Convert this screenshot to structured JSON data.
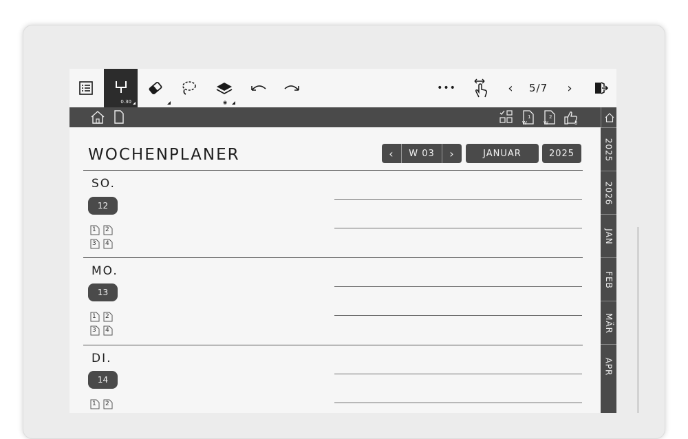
{
  "toolbar": {
    "pen_size": "0.30",
    "page_indicator": "5/7",
    "more_label": "•••"
  },
  "page": {
    "title": "WOCHENPLANER",
    "week_label": "W 03",
    "month_label": "JANUAR",
    "year_label": "2025"
  },
  "side_tabs": [
    "2025",
    "2026",
    "JAN",
    "FEB",
    "MÄR",
    "APR"
  ],
  "days": [
    {
      "name": "SO.",
      "date": "12",
      "notes": [
        "1",
        "2",
        "3",
        "4"
      ]
    },
    {
      "name": "MO.",
      "date": "13",
      "notes": [
        "1",
        "2",
        "3",
        "4"
      ]
    },
    {
      "name": "DI.",
      "date": "14",
      "notes": [
        "1",
        "2"
      ]
    }
  ],
  "colors": {
    "dark_bar": "#4a4a4a",
    "paper": "#f6f6f6"
  }
}
